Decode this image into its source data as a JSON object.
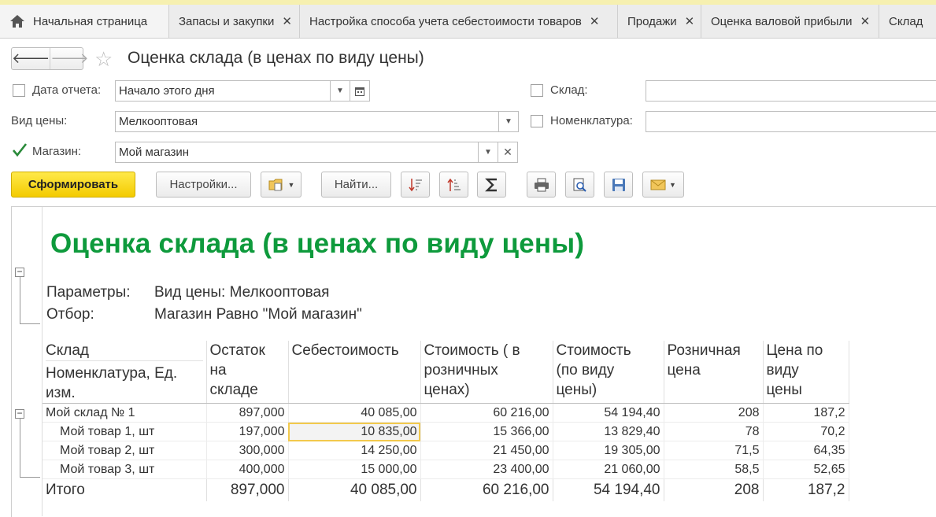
{
  "tabs": [
    {
      "label": "Начальная страница"
    },
    {
      "label": "Запасы и закупки"
    },
    {
      "label": "Настройка способа учета себестоимости товаров"
    },
    {
      "label": "Продажи"
    },
    {
      "label": "Оценка валовой прибыли"
    },
    {
      "label": "Склад"
    }
  ],
  "tab_close": "✕",
  "header": {
    "title": "Оценка склада (в ценах по виду цены)"
  },
  "form": {
    "report_date_label": "Дата отчета:",
    "report_date_value": "Начало этого дня",
    "price_type_label": "Вид цены:",
    "price_type_value": "Мелкооптовая",
    "store_label": "Магазин:",
    "store_value": "Мой магазин",
    "warehouse_label": "Склад:",
    "nomenclature_label": "Номенклатура:"
  },
  "toolbar": {
    "generate": "Сформировать",
    "settings": "Настройки...",
    "find": "Найти..."
  },
  "report": {
    "title": "Оценка склада (в ценах по виду цены)",
    "params_label": "Параметры:",
    "params_value": "Вид цены: Мелкооптовая",
    "filter_label": "Отбор:",
    "filter_value": "Магазин Равно \"Мой магазин\"",
    "columns": {
      "c1a": "Склад",
      "c1b": "Номенклатура, Ед.",
      "c1c": "изм.",
      "c2a": "Остаток",
      "c2b": "на",
      "c2c": "складе",
      "c3": "Себестоимость",
      "c4a": "Стоимость ( в",
      "c4b": "розничных",
      "c4c": "ценах)",
      "c5a": "Стоимость",
      "c5b": "(по виду",
      "c5c": "цены)",
      "c6a": "Розничная",
      "c6b": "цена",
      "c7a": "Цена по",
      "c7b": "виду",
      "c7c": "цены"
    },
    "rows": [
      {
        "name": "Мой склад № 1",
        "qty": "897,000",
        "cost": "40 085,00",
        "retail_value": "60 216,00",
        "price_value": "54 194,40",
        "retail_price": "208",
        "price": "187,2"
      },
      {
        "name": "Мой товар 1, шт",
        "qty": "197,000",
        "cost": "10 835,00",
        "retail_value": "15 366,00",
        "price_value": "13 829,40",
        "retail_price": "78",
        "price": "70,2"
      },
      {
        "name": "Мой товар 2, шт",
        "qty": "300,000",
        "cost": "14 250,00",
        "retail_value": "21 450,00",
        "price_value": "19 305,00",
        "retail_price": "71,5",
        "price": "64,35"
      },
      {
        "name": "Мой товар 3, шт",
        "qty": "400,000",
        "cost": "15 000,00",
        "retail_value": "23 400,00",
        "price_value": "21 060,00",
        "retail_price": "58,5",
        "price": "52,65"
      }
    ],
    "total": {
      "name": "Итого",
      "qty": "897,000",
      "cost": "40 085,00",
      "retail_value": "60 216,00",
      "price_value": "54 194,40",
      "retail_price": "208",
      "price": "187,2"
    }
  }
}
